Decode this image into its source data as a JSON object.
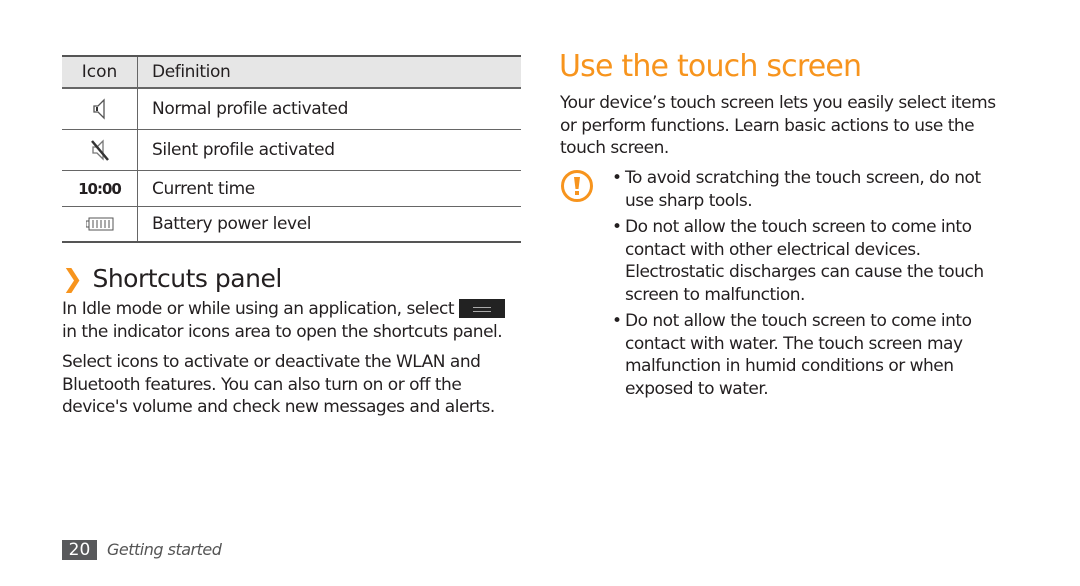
{
  "table": {
    "headers": [
      "Icon",
      "Definition"
    ],
    "rows": [
      {
        "icon": "speaker-icon",
        "definition": "Normal profile activated"
      },
      {
        "icon": "speaker-muted-icon",
        "definition": "Silent profile activated"
      },
      {
        "icon": "clock-time",
        "icon_text": "10:00",
        "definition": "Current time"
      },
      {
        "icon": "battery-icon",
        "definition": "Battery power level"
      }
    ]
  },
  "shortcuts": {
    "chevron": "❯",
    "title": "Shortcuts panel",
    "p1_before": "In Idle mode or while using an application, select",
    "p1_after": "in the indicator icons area to open the shortcuts panel.",
    "p2": "Select icons to activate or deactivate the WLAN and Bluetooth features. You can also turn on or off the device's volume and check new messages and alerts."
  },
  "touch": {
    "title": "Use the touch screen",
    "intro": "Your device’s touch screen lets you easily select items or perform functions. Learn basic actions to use the touch screen.",
    "bullets": [
      "To avoid scratching the touch screen, do not use sharp tools.",
      "Do not allow the touch screen to come into contact with other electrical devices. Electrostatic discharges can cause the touch screen to malfunction.",
      "Do not allow the touch screen to come into contact with water. The touch screen may malfunction in humid conditions or when exposed to water."
    ]
  },
  "footer": {
    "page": "20",
    "section": "Getting started"
  },
  "colors": {
    "accent": "#f7941d",
    "header_bg": "#e6e6e6",
    "page_box": "#58595b"
  }
}
